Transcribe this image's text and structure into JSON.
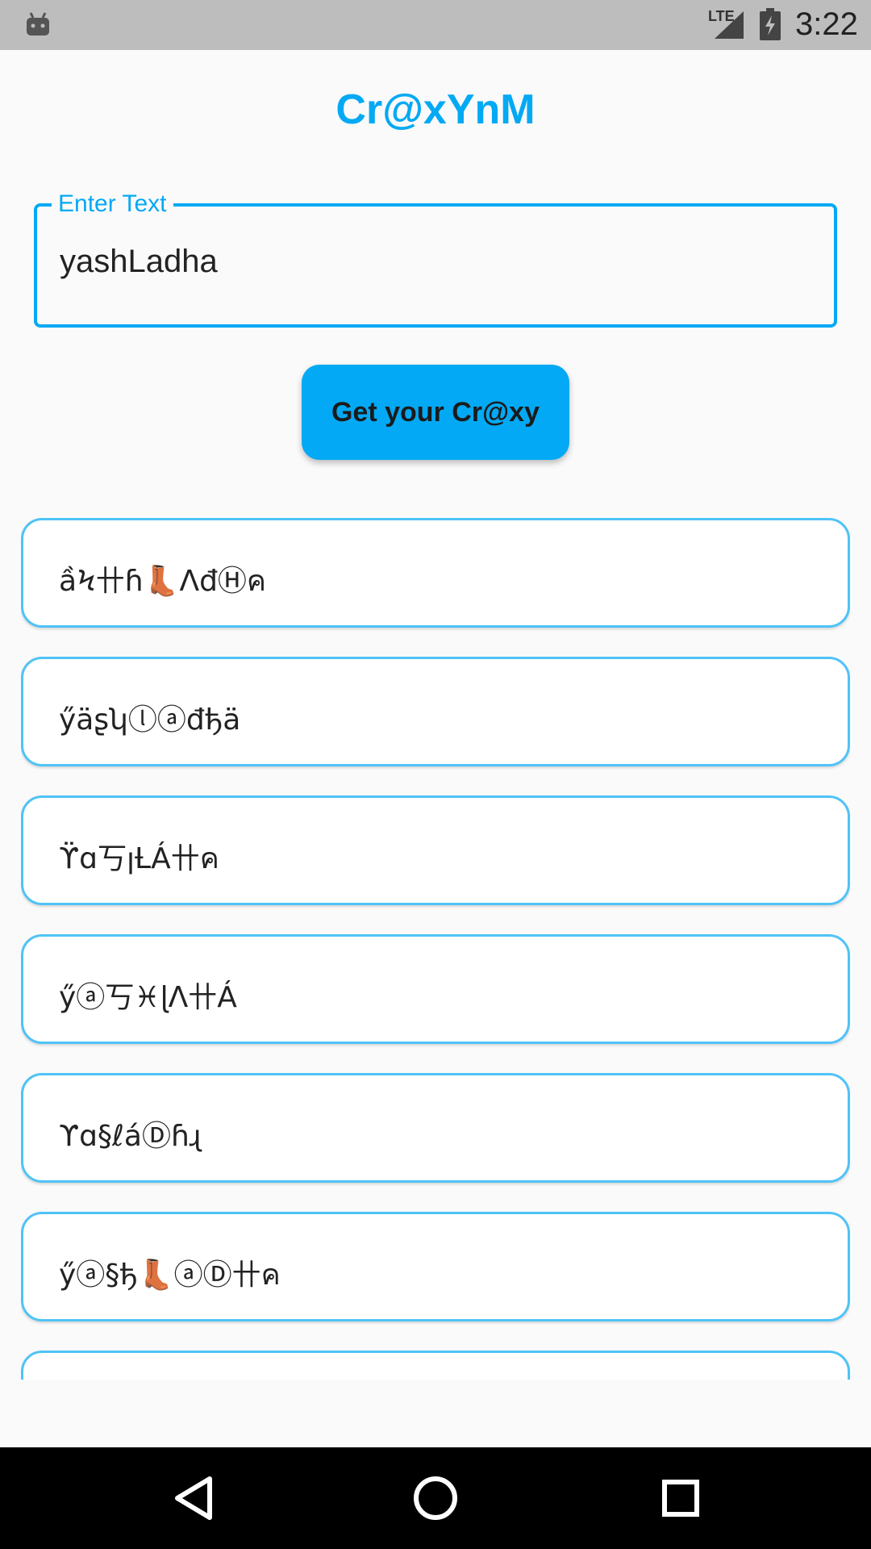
{
  "status_bar": {
    "network_label": "LTE",
    "time": "3:22",
    "icons": [
      "android-icon",
      "signal-icon",
      "battery-charging-icon"
    ]
  },
  "app": {
    "title": "Cr@xYnM"
  },
  "input": {
    "label": "Enter Text",
    "value": "yashLadha"
  },
  "button": {
    "label": "Get your Cr@xy"
  },
  "results": [
    "ầϞ卄ɦ👢ΛđⒽค",
    "ӳäʂʮⓛⓐđђä",
    "ϔɑ丂ꞁȽÁ卄ค",
    "ӳⓐ丂♓ɭΛ卄Á",
    "ϒɑ§ℓáⒹɦɻ",
    "ӳⓐ§ђ👢ⓐⒹ卄ค",
    ""
  ],
  "nav_bar": {
    "icons": [
      "back-icon",
      "home-icon",
      "recents-icon"
    ]
  },
  "colors": {
    "accent": "#03a9f4",
    "card_border": "#4fc3f7",
    "status_bar": "#bdbdbd",
    "nav_bar": "#000000"
  }
}
